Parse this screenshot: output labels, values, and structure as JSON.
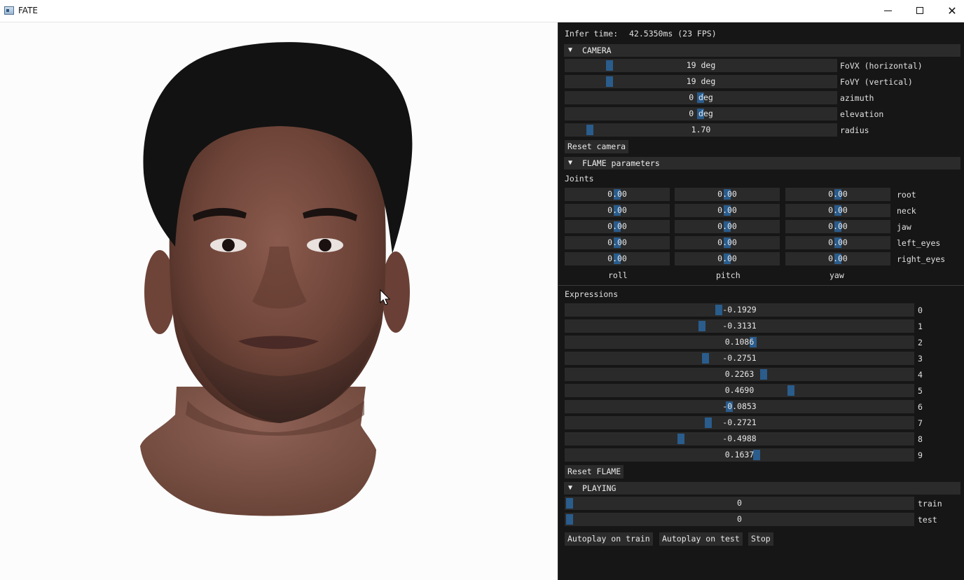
{
  "window": {
    "title": "FATE"
  },
  "status": {
    "infer_label": "Infer time:",
    "infer_value": "42.5350ms (23 FPS)"
  },
  "camera": {
    "header": "CAMERA",
    "sliders": [
      {
        "label": "FoVX (horizontal)",
        "value": "19 deg",
        "level": 0.16
      },
      {
        "label": "FoVY (vertical)",
        "value": "19 deg",
        "level": 0.16
      },
      {
        "label": "azimuth",
        "value": "0 deg",
        "level": 0.5
      },
      {
        "label": "elevation",
        "value": "0 deg",
        "level": 0.5
      },
      {
        "label": "radius",
        "value": "1.70",
        "level": 0.09
      }
    ],
    "reset_label": "Reset camera"
  },
  "flame": {
    "header": "FLAME parameters",
    "joints_label": "Joints",
    "joints": [
      {
        "label": "root",
        "values": [
          "0.00",
          "0.00",
          "0.00"
        ]
      },
      {
        "label": "neck",
        "values": [
          "0.00",
          "0.00",
          "0.00"
        ]
      },
      {
        "label": "jaw",
        "values": [
          "0.00",
          "0.00",
          "0.00"
        ]
      },
      {
        "label": "left_eyes",
        "values": [
          "0.00",
          "0.00",
          "0.00"
        ]
      },
      {
        "label": "right_eyes",
        "values": [
          "0.00",
          "0.00",
          "0.00"
        ]
      }
    ],
    "axes": [
      "roll",
      "pitch",
      "yaw"
    ],
    "expressions_label": "Expressions",
    "expressions": [
      {
        "label": "0",
        "value": "-0.1929",
        "level": 0.44
      },
      {
        "label": "1",
        "value": "-0.3131",
        "level": 0.39
      },
      {
        "label": "2",
        "value": "0.1086",
        "level": 0.54
      },
      {
        "label": "3",
        "value": "-0.2751",
        "level": 0.4
      },
      {
        "label": "4",
        "value": "0.2263",
        "level": 0.57
      },
      {
        "label": "5",
        "value": "0.4690",
        "level": 0.65
      },
      {
        "label": "6",
        "value": "-0.0853",
        "level": 0.47
      },
      {
        "label": "7",
        "value": "-0.2721",
        "level": 0.41
      },
      {
        "label": "8",
        "value": "-0.4988",
        "level": 0.33
      },
      {
        "label": "9",
        "value": "0.1637",
        "level": 0.55
      }
    ],
    "reset_label": "Reset FLAME"
  },
  "playing": {
    "header": "PLAYING",
    "sliders": [
      {
        "label": "train",
        "value": "0",
        "level": 0.0
      },
      {
        "label": "test",
        "value": "0",
        "level": 0.0
      }
    ],
    "buttons": [
      "Autoplay on train",
      "Autoplay on test",
      "Stop"
    ]
  },
  "colors": {
    "accent": "#2a5c8c",
    "panel_bg": "#161616",
    "frame_bg": "#2a2a2a",
    "header_bg": "#2b2b2b"
  }
}
